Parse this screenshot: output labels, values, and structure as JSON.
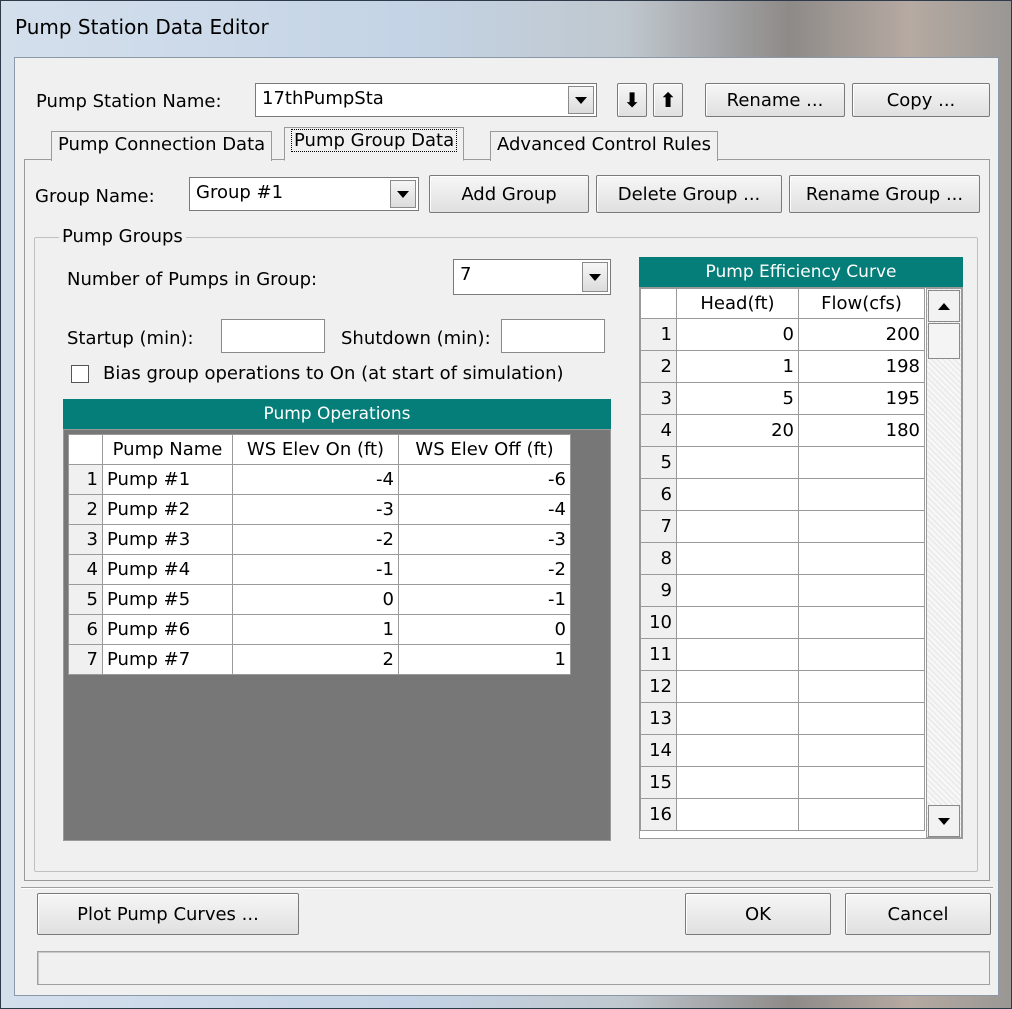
{
  "window": {
    "title": "Pump Station Data Editor"
  },
  "station": {
    "name_label": "Pump Station Name:",
    "name_value": "17thPumpSta",
    "down_arrow": "⬇",
    "up_arrow": "⬆",
    "rename_label": "Rename ...",
    "copy_label": "Copy ..."
  },
  "tabs": [
    {
      "label": "Pump Connection Data"
    },
    {
      "label": "Pump Group Data"
    },
    {
      "label": "Advanced Control Rules"
    }
  ],
  "group": {
    "name_label": "Group Name:",
    "name_value": "Group #1",
    "add_label": "Add Group",
    "delete_label": "Delete Group ...",
    "rename_label": "Rename Group ..."
  },
  "pump_groups": {
    "box_label": "Pump Groups",
    "num_pumps_label": "Number of Pumps in Group:",
    "num_pumps_value": "7",
    "startup_label": "Startup (min):",
    "startup_value": "",
    "shutdown_label": "Shutdown (min):",
    "shutdown_value": "",
    "bias_label": "Bias group operations to On (at start of simulation)",
    "bias_checked": false
  },
  "pump_operations": {
    "title": "Pump Operations",
    "columns": [
      "Pump Name",
      "WS Elev On (ft)",
      "WS Elev Off (ft)"
    ],
    "rows": [
      {
        "n": "1",
        "name": "Pump #1",
        "on": "-4",
        "off": "-6"
      },
      {
        "n": "2",
        "name": "Pump #2",
        "on": "-3",
        "off": "-4"
      },
      {
        "n": "3",
        "name": "Pump #3",
        "on": "-2",
        "off": "-3"
      },
      {
        "n": "4",
        "name": "Pump #4",
        "on": "-1",
        "off": "-2"
      },
      {
        "n": "5",
        "name": "Pump #5",
        "on": "0",
        "off": "-1"
      },
      {
        "n": "6",
        "name": "Pump #6",
        "on": "1",
        "off": "0"
      },
      {
        "n": "7",
        "name": "Pump #7",
        "on": "2",
        "off": "1"
      }
    ]
  },
  "efficiency": {
    "title": "Pump Efficiency Curve",
    "columns": [
      "Head(ft)",
      "Flow(cfs)"
    ],
    "rows": [
      {
        "n": "1",
        "head": "0",
        "flow": "200"
      },
      {
        "n": "2",
        "head": "1",
        "flow": "198"
      },
      {
        "n": "3",
        "head": "5",
        "flow": "195"
      },
      {
        "n": "4",
        "head": "20",
        "flow": "180"
      },
      {
        "n": "5",
        "head": "",
        "flow": ""
      },
      {
        "n": "6",
        "head": "",
        "flow": ""
      },
      {
        "n": "7",
        "head": "",
        "flow": ""
      },
      {
        "n": "8",
        "head": "",
        "flow": ""
      },
      {
        "n": "9",
        "head": "",
        "flow": ""
      },
      {
        "n": "10",
        "head": "",
        "flow": ""
      },
      {
        "n": "11",
        "head": "",
        "flow": ""
      },
      {
        "n": "12",
        "head": "",
        "flow": ""
      },
      {
        "n": "13",
        "head": "",
        "flow": ""
      },
      {
        "n": "14",
        "head": "",
        "flow": ""
      },
      {
        "n": "15",
        "head": "",
        "flow": ""
      },
      {
        "n": "16",
        "head": "",
        "flow": ""
      }
    ]
  },
  "footer": {
    "plot_label": "Plot Pump Curves ...",
    "ok_label": "OK",
    "cancel_label": "Cancel",
    "status_text": ""
  }
}
